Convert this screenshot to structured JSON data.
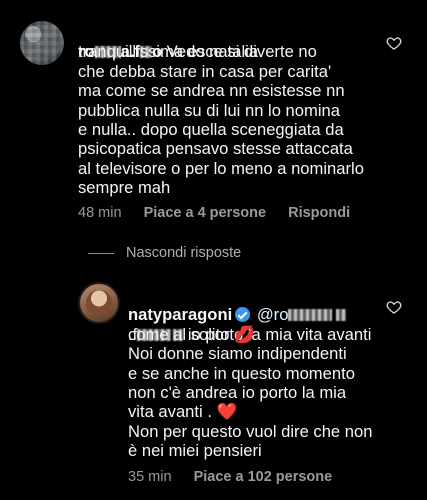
{
  "comment1": {
    "username_visible_start": "ro",
    "username_visible_mid": "a.f",
    "username_visible_end": "o",
    "text_after_username": " Vedo natalia",
    "body": "tranquillissima esce si diverte no\nche debba stare in casa per carita'\nma come se andrea nn esistesse nn\npubblica nulla su di lui nn lo nomina\ne nulla.. dopo quella sceneggiata da\npsicopatica pensavo stesse attaccata\nal televisore o per lo meno a nominarlo\nsempre mah",
    "time": "48 min",
    "likes": "Piace a 4 persone",
    "reply": "Rispondi"
  },
  "replies_toggle": "Nascondi risposte",
  "comment2": {
    "username": "natyparagoni",
    "mention_start": "@ro",
    "mention_line2_start": ".f",
    "line1_after_mention": " io porto la mia vita avanti",
    "body": "come al solito 💋\nNoi donne siamo indipendenti\ne se anche in questo momento\nnon c'è andrea io porto la mia\nvita avanti . ❤️\nNon per questo vuol dire che non\nè nei miei pensieri",
    "time": "35 min",
    "likes": "Piace a 102 persone"
  },
  "colors": {
    "background": "#000000",
    "text": "#f5f5f5",
    "meta": "#9a9a9a",
    "verified": "#3897f0"
  }
}
